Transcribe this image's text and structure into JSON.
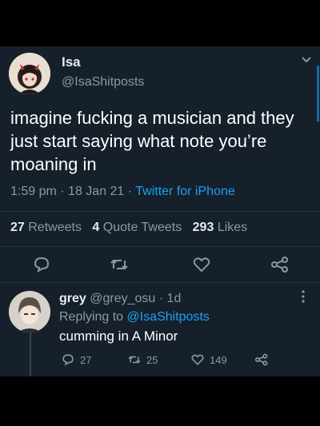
{
  "main_tweet": {
    "display_name": "Isa",
    "handle": "@IsaShitposts",
    "text": "imagine fucking a musician and they just start saying what note you’re moaning in",
    "time": "1:59 pm",
    "dot1": "·",
    "date": "18 Jan 21",
    "dot2": "·",
    "source": "Twitter for iPhone",
    "retweets_count": "27",
    "retweets_label": "Retweets",
    "quote_count": "4",
    "quote_label": "Quote Tweets",
    "likes_count": "293",
    "likes_label": "Likes"
  },
  "reply": {
    "display_name": "grey",
    "handle": "@grey_osu",
    "separator": "·",
    "age": "1d",
    "replying_prefix": "Replying to",
    "replying_to": "@IsaShitposts",
    "text": "cumming in A Minor",
    "reply_count": "27",
    "retweet_count": "25",
    "like_count": "149"
  },
  "icons": {
    "reply": "reply-bubble-icon",
    "retweet": "retweet-icon",
    "like": "heart-icon",
    "share": "share-icon",
    "more": "chevron-down-icon",
    "reply_more": "vertical-dots-icon"
  },
  "colors": {
    "background": "#15202b",
    "accent": "#1da1f2",
    "muted": "#8899a6"
  }
}
